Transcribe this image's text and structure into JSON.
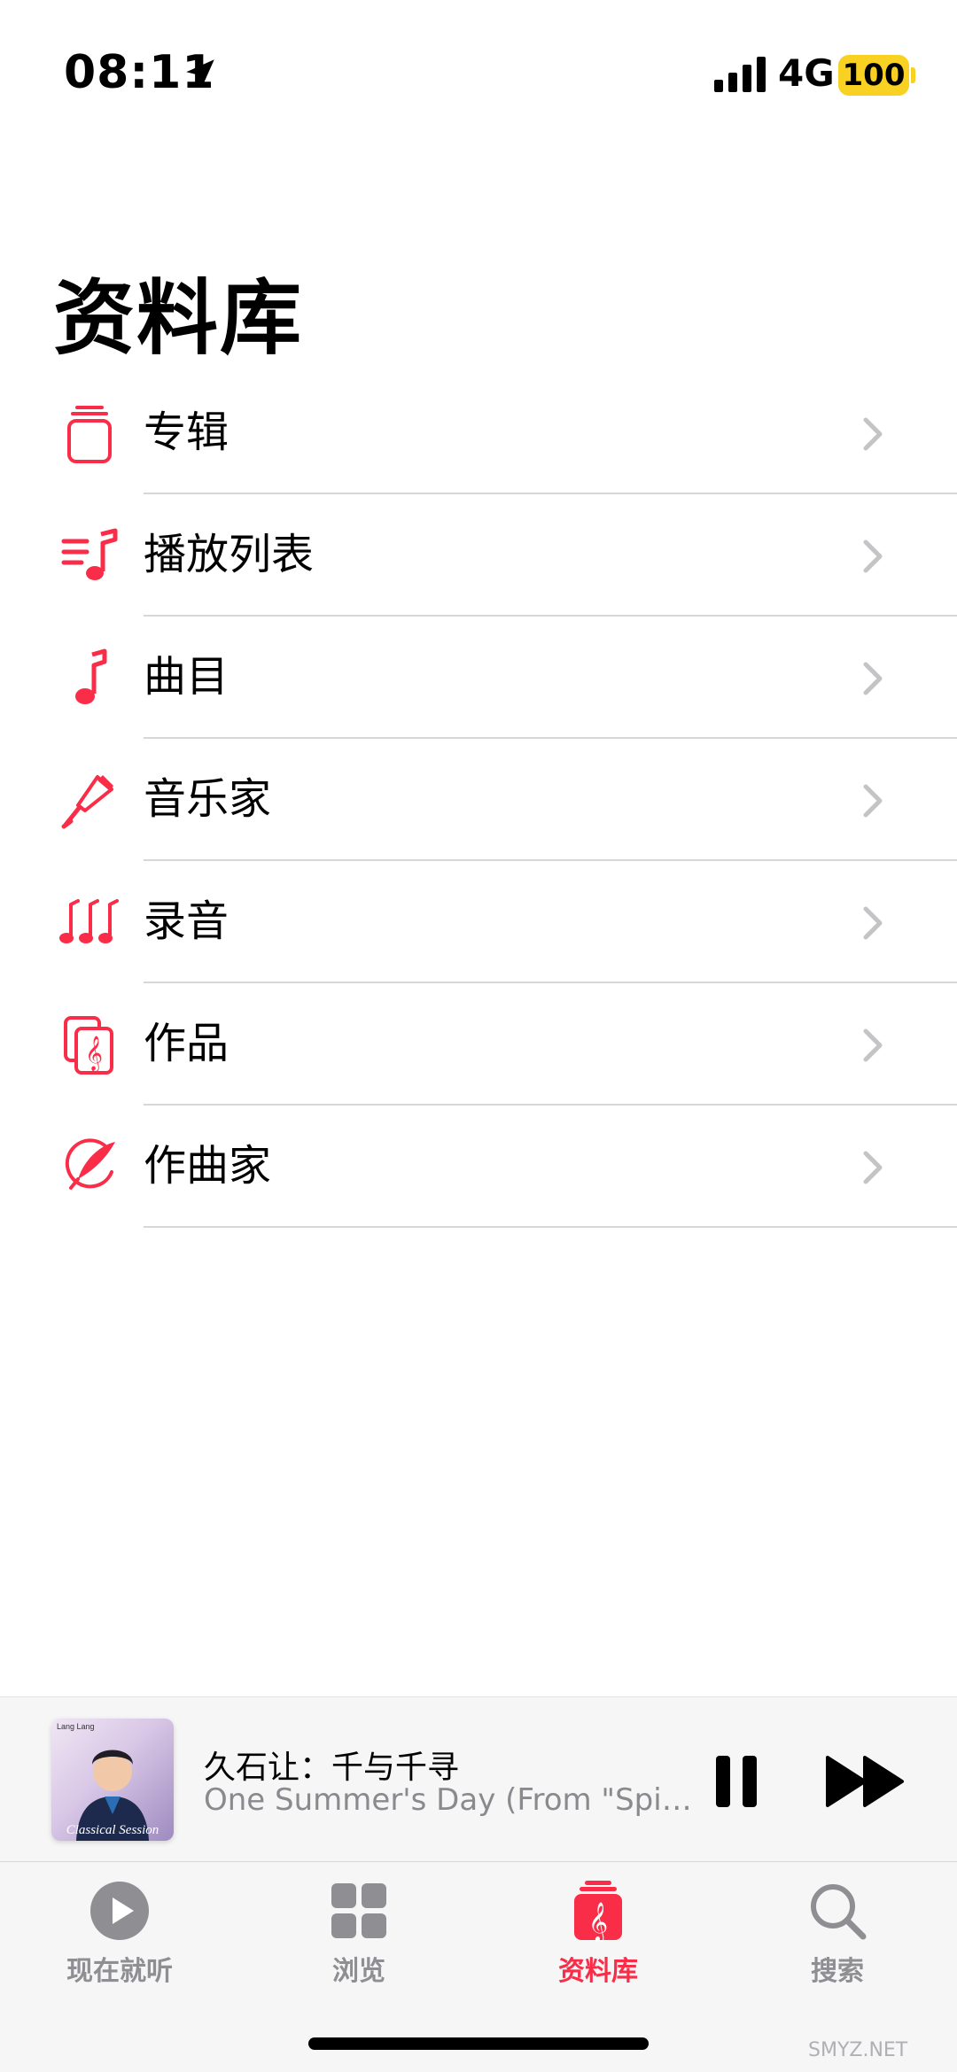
{
  "status_bar": {
    "time": "08:11",
    "network": "4G",
    "battery": "100",
    "battery_color": "#f8d123"
  },
  "page": {
    "title": "资料库",
    "accent": "#fa2d48"
  },
  "library_items": [
    {
      "label": "专辑",
      "icon": "album-stack-icon"
    },
    {
      "label": "播放列表",
      "icon": "playlist-icon"
    },
    {
      "label": "曲目",
      "icon": "music-note-icon"
    },
    {
      "label": "音乐家",
      "icon": "microphone-icon"
    },
    {
      "label": "录音",
      "icon": "music-notes-icon"
    },
    {
      "label": "作品",
      "icon": "score-icon"
    },
    {
      "label": "作曲家",
      "icon": "quill-icon"
    }
  ],
  "now_playing": {
    "title": "久石让：千与千寻",
    "subtitle": "One Summer's Day (From \"Spiri...",
    "art_top_text": "Lang Lang",
    "art_bottom_text": "Classical Session"
  },
  "tabs": [
    {
      "label": "现在就听",
      "icon": "play-circle-icon",
      "active": false
    },
    {
      "label": "浏览",
      "icon": "grid-icon",
      "active": false
    },
    {
      "label": "资料库",
      "icon": "library-icon",
      "active": true
    },
    {
      "label": "搜索",
      "icon": "search-icon",
      "active": false
    }
  ],
  "watermark": "SMYZ.NET"
}
